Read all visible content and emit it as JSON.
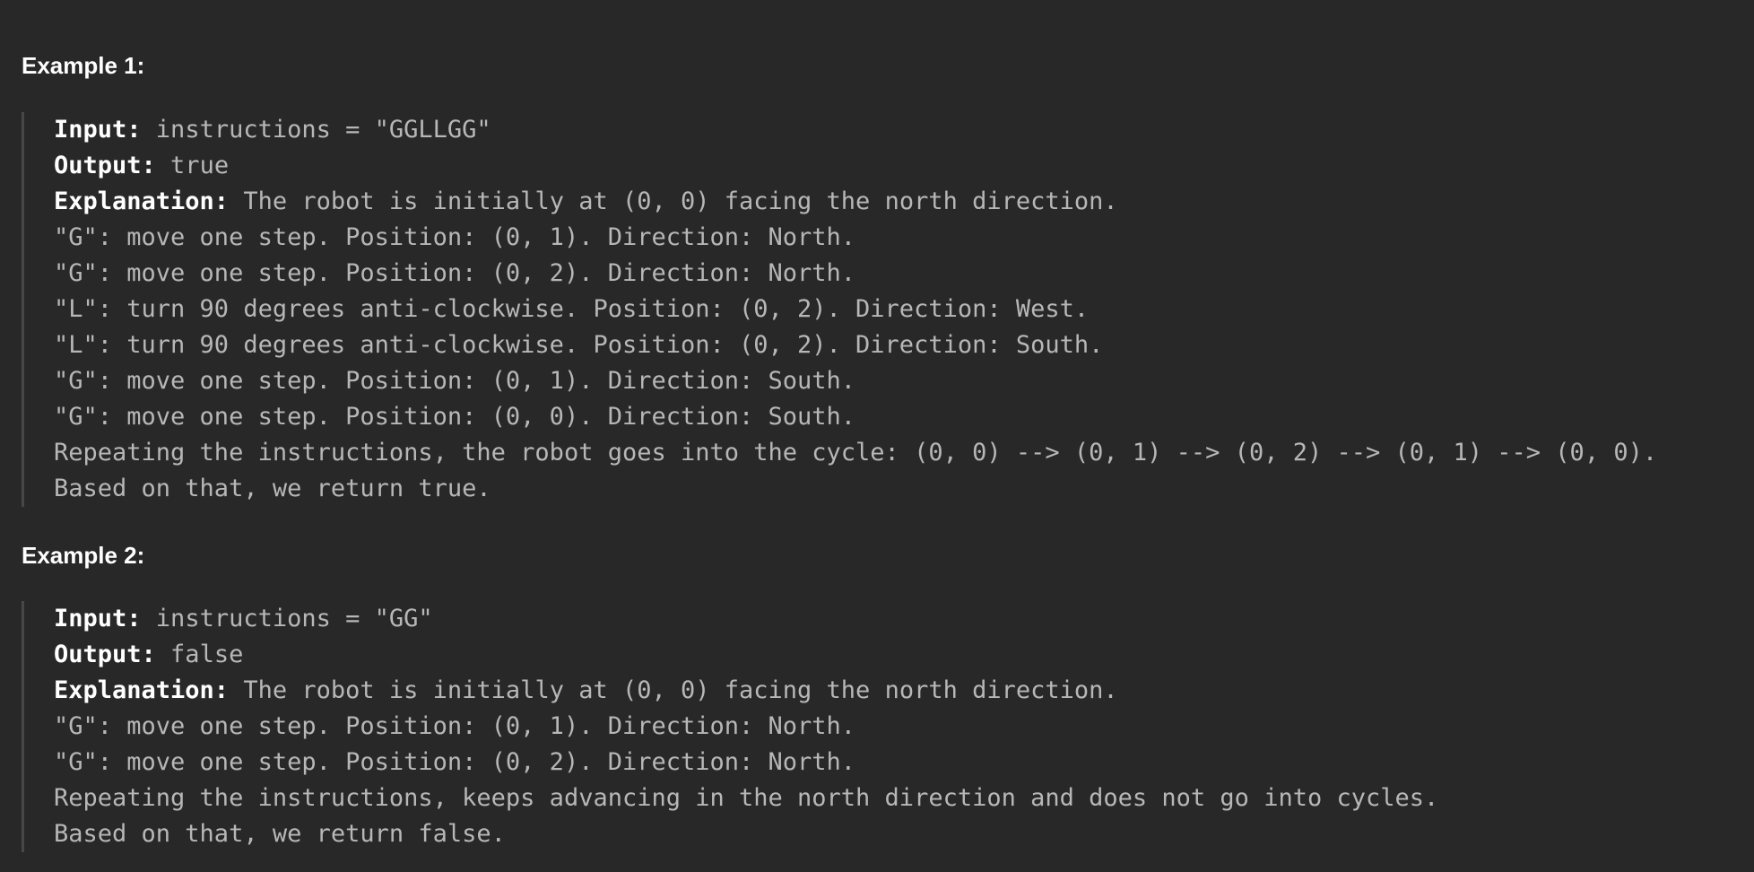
{
  "examples": [
    {
      "heading": "Example 1:",
      "input_label": "Input:",
      "input_value": " instructions = \"GGLLGG\"",
      "output_label": "Output:",
      "output_value": " true",
      "explanation_label": "Explanation:",
      "explanation_value": " The robot is initially at (0, 0) facing the north direction.",
      "lines": [
        "\"G\": move one step. Position: (0, 1). Direction: North.",
        "\"G\": move one step. Position: (0, 2). Direction: North.",
        "\"L\": turn 90 degrees anti-clockwise. Position: (0, 2). Direction: West.",
        "\"L\": turn 90 degrees anti-clockwise. Position: (0, 2). Direction: South.",
        "\"G\": move one step. Position: (0, 1). Direction: South.",
        "\"G\": move one step. Position: (0, 0). Direction: South.",
        "Repeating the instructions, the robot goes into the cycle: (0, 0) --> (0, 1) --> (0, 2) --> (0, 1) --> (0, 0).",
        "Based on that, we return true."
      ]
    },
    {
      "heading": "Example 2:",
      "input_label": "Input:",
      "input_value": " instructions = \"GG\"",
      "output_label": "Output:",
      "output_value": " false",
      "explanation_label": "Explanation:",
      "explanation_value": " The robot is initially at (0, 0) facing the north direction.",
      "lines": [
        "\"G\": move one step. Position: (0, 1). Direction: North.",
        "\"G\": move one step. Position: (0, 2). Direction: North.",
        "Repeating the instructions, keeps advancing in the north direction and does not go into cycles.",
        "Based on that, we return false."
      ]
    }
  ]
}
